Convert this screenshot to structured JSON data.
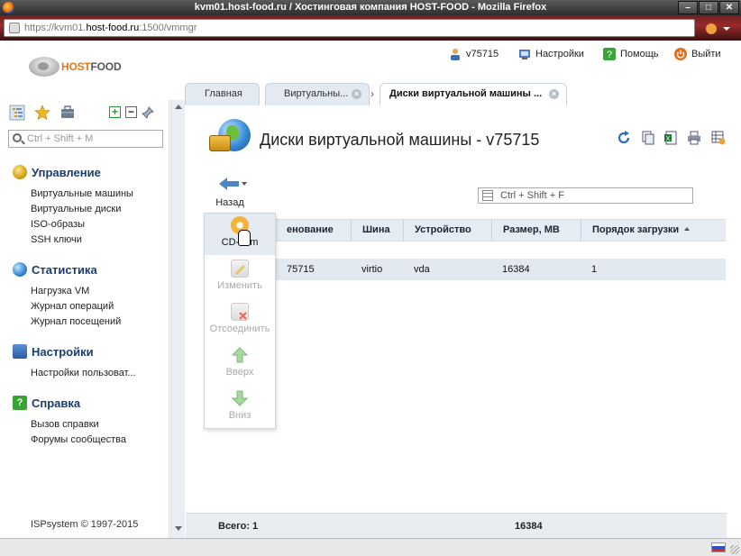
{
  "browser": {
    "window_title": "kvm01.host-food.ru / Хостинговая компания HOST-FOOD - Mozilla Firefox",
    "url_prefix": "https://kvm01.",
    "url_host": "host-food.ru",
    "url_suffix": ":1500/vmmgr"
  },
  "header": {
    "logo_part1": "HOST",
    "logo_part2": "FOOD",
    "user": "v75715",
    "settings": "Настройки",
    "help": "Помощь",
    "logout": "Выйти"
  },
  "sidebar": {
    "search_placeholder": "Ctrl + Shift + M",
    "groups": [
      {
        "title": "Управление",
        "items": [
          "Виртуальные машины",
          "Виртуальные диски",
          "ISO-образы",
          "SSH ключи"
        ]
      },
      {
        "title": "Статистика",
        "items": [
          "Нагрузка VM",
          "Журнал операций",
          "Журнал посещений"
        ]
      },
      {
        "title": "Настройки",
        "items": [
          "Настройки пользоват..."
        ]
      },
      {
        "title": "Справка",
        "items": [
          "Вызов справки",
          "Форумы сообщества"
        ]
      }
    ],
    "footer": "ISPsystem © 1997-2015"
  },
  "tabs": [
    {
      "label": "Главная",
      "closable": false
    },
    {
      "label": "Виртуальны...",
      "closable": true
    },
    {
      "label": "Диски виртуальной машины ...",
      "closable": true,
      "active": true
    }
  ],
  "main": {
    "title": "Диски виртуальной машины - v75715",
    "back_label": "Назад",
    "search_placeholder": "Ctrl + Shift + F",
    "columns": [
      "Наименование",
      "Шина",
      "Устройство",
      "Размер, MB",
      "Порядок загрузки"
    ],
    "columns_visible": [
      "енование",
      "Шина",
      "Устройство",
      "Размер, MB",
      "Порядок загрузки"
    ],
    "rows": [
      {
        "name": "v75715",
        "name_visible": "75715",
        "bus": "virtio",
        "device": "vda",
        "size": "16384",
        "boot": "1"
      }
    ],
    "footer_label": "Всего: 1",
    "footer_sum": "16384"
  },
  "menu": {
    "items": [
      "CD-Rom",
      "Изменить",
      "Отсоединить",
      "Вверх",
      "Вниз"
    ],
    "cdrom_visible": "CD-",
    "cdrom_tail": "m"
  },
  "colors": {
    "accent": "#1a3c6e",
    "tab_bg": "#e4eaf1",
    "header_row": "#e6ecf3",
    "selected_row": "#e3e9f0"
  }
}
